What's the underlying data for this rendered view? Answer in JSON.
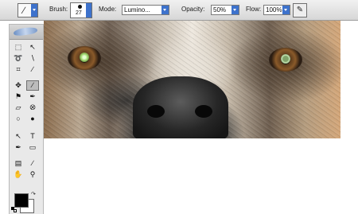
{
  "options_bar": {
    "brush_label": "Brush:",
    "brush_size": "27",
    "mode_label": "Mode:",
    "mode_value": "Lumino...",
    "opacity_label": "Opacity:",
    "opacity_value": "50%",
    "flow_label": "Flow:",
    "flow_value": "100%"
  },
  "tools": [
    "marquee-tool",
    "move-tool",
    "lasso-tool",
    "magic-wand-tool",
    "crop-tool",
    "slice-tool",
    "healing-brush-tool",
    "brush-tool",
    "clone-stamp-tool",
    "history-brush-tool",
    "eraser-tool",
    "paint-bucket-tool",
    "blur-tool",
    "dodge-tool",
    "path-selection-tool",
    "type-tool",
    "pen-tool",
    "shape-tool",
    "notes-tool",
    "eyedropper-tool",
    "hand-tool",
    "zoom-tool"
  ],
  "colors": {
    "foreground": "#000000",
    "background": "#ffffff",
    "accent": "#3d72cc"
  }
}
